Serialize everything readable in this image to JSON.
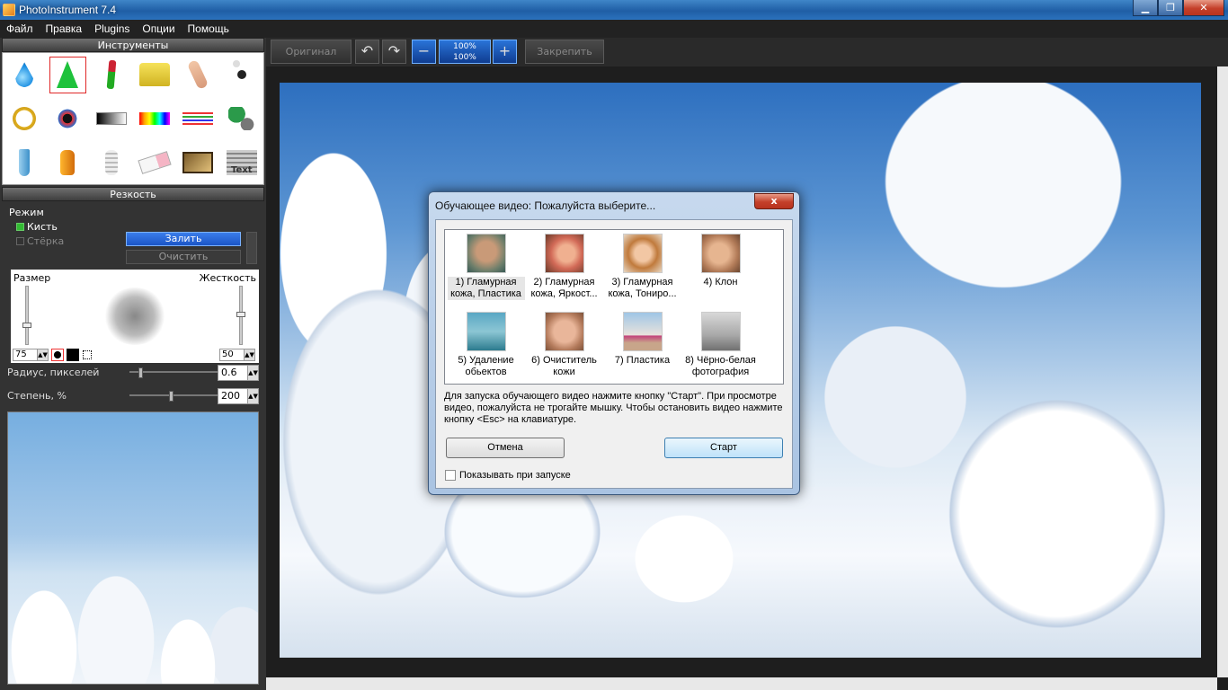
{
  "window": {
    "title": "PhotoInstrument 7.4",
    "minimize": "▁",
    "maximize": "❐",
    "close": "✕"
  },
  "menu": [
    "Файл",
    "Правка",
    "Plugins",
    "Опции",
    "Помощь"
  ],
  "tools_panel": {
    "title": "Инструменты",
    "selected_tool": "tool-cone",
    "text_tool_label": "Text"
  },
  "sharp_panel": {
    "title": "Резкость",
    "mode_label": "Режим",
    "brush_label": "Кисть",
    "eraser_label": "Стёрка",
    "fill_button": "Залить",
    "clear_button": "Очистить",
    "size_label": "Размер",
    "hardness_label": "Жесткость",
    "size_value": "75",
    "hardness_value": "50",
    "radius_label": "Радиус, пикселей",
    "radius_value": "0.6",
    "degree_label": "Степень, %",
    "degree_value": "200"
  },
  "toolbar": {
    "original": "Оригинал",
    "zoom_top": "100%",
    "zoom_bottom": "100%",
    "pin": "Закрепить",
    "undo_glyph": "↶",
    "redo_glyph": "↷",
    "zoom_out_glyph": "−",
    "zoom_in_glyph": "+"
  },
  "dialog": {
    "title": "Обучающее видео: Пожалуйста выберите...",
    "close": "x",
    "items": [
      "1) Гламурная кожа, Пластика",
      "2) Гламурная кожа, Яркост...",
      "3) Гламурная кожа, Тониро...",
      "4) Клон",
      "5) Удаление обьектов",
      "6) Очиститель кожи",
      "7) Пластика",
      "8) Чёрно-белая фотография"
    ],
    "instructions": "Для запуска обучающего видео нажмите кнопку \"Старт\". При просмотре видео, пожалуйста не трогайте мышку. Чтобы остановить видео нажмите кнопку <Esc> на клавиатуре.",
    "cancel": "Отмена",
    "start": "Старт",
    "show_on_start": "Показывать при запуске"
  },
  "icons": {
    "tools": [
      "drop",
      "cone",
      "brush",
      "stamp",
      "finger",
      "pin",
      "clock",
      "eye",
      "gradient",
      "rainbow",
      "lines",
      "scissors",
      "tube",
      "bottle",
      "bulb",
      "eraser",
      "film",
      "text"
    ]
  }
}
